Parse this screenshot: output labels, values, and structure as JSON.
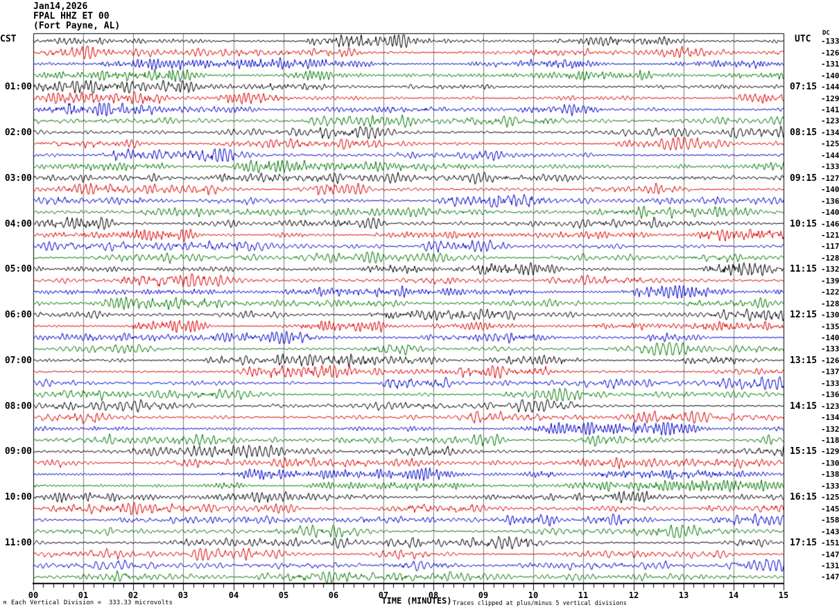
{
  "title_block": {
    "date": "Jan14,2026",
    "station": "FPAL HHZ ET 00",
    "location": "(Fort Payne, AL)"
  },
  "corner_labels": {
    "left_timezone": "CST",
    "right_timezone": "UTC",
    "dc_header": "DC"
  },
  "footer": {
    "mark": "M",
    "scale_note": "Each Vertical Division =  333.33 microvolts",
    "axis_title": "TIME (MINUTES)",
    "clip_note": "Traces clipped at plus/minus 5 vertical divisions"
  },
  "chart_data": {
    "type": "line",
    "subtype": "helicorder-seismogram",
    "station": "FPAL HHZ ET 00 (Fort Payne, AL)",
    "date": "Jan14,2026",
    "xlabel": "TIME (MINUTES)",
    "x_tick_labels": [
      "00",
      "01",
      "02",
      "03",
      "04",
      "05",
      "06",
      "07",
      "08",
      "09",
      "10",
      "11",
      "12",
      "13",
      "14",
      "15"
    ],
    "minutes_per_line": 15,
    "minor_ticks_per_minute": 5,
    "lines_per_hour": 4,
    "left_timezone": "CST",
    "right_timezone": "UTC",
    "volts_per_division": "333.33 microvolts",
    "clip_divisions": 5,
    "grid_on": true,
    "grid_color": "#7a7a7a",
    "trace_colors": [
      "#000000",
      "#dd0000",
      "#0000cc",
      "#007700"
    ],
    "waveform": {
      "description": "continuous microseismic background noise with spindle-shaped amplitude bursts on every line, clipped at plus/minus 5 vertical divisions",
      "seed": 20260114
    },
    "rows": [
      {
        "cst": "",
        "utc": "",
        "dc": "-133"
      },
      {
        "cst": "",
        "utc": "",
        "dc": "-126"
      },
      {
        "cst": "",
        "utc": "",
        "dc": "-131"
      },
      {
        "cst": "",
        "utc": "",
        "dc": "-140"
      },
      {
        "cst": "01:00",
        "utc": "07:15",
        "dc": "-144"
      },
      {
        "cst": "",
        "utc": "",
        "dc": "-129"
      },
      {
        "cst": "",
        "utc": "",
        "dc": "-141"
      },
      {
        "cst": "",
        "utc": "",
        "dc": "-123"
      },
      {
        "cst": "02:00",
        "utc": "08:15",
        "dc": "-134"
      },
      {
        "cst": "",
        "utc": "",
        "dc": "-125"
      },
      {
        "cst": "",
        "utc": "",
        "dc": "-144"
      },
      {
        "cst": "",
        "utc": "",
        "dc": "-133"
      },
      {
        "cst": "03:00",
        "utc": "09:15",
        "dc": "-127"
      },
      {
        "cst": "",
        "utc": "",
        "dc": "-140"
      },
      {
        "cst": "",
        "utc": "",
        "dc": "-136"
      },
      {
        "cst": "",
        "utc": "",
        "dc": "-140"
      },
      {
        "cst": "04:00",
        "utc": "10:15",
        "dc": "-146"
      },
      {
        "cst": "",
        "utc": "",
        "dc": "-121"
      },
      {
        "cst": "",
        "utc": "",
        "dc": "-117"
      },
      {
        "cst": "",
        "utc": "",
        "dc": "-128"
      },
      {
        "cst": "05:00",
        "utc": "11:15",
        "dc": "-132"
      },
      {
        "cst": "",
        "utc": "",
        "dc": "-139"
      },
      {
        "cst": "",
        "utc": "",
        "dc": "-122"
      },
      {
        "cst": "",
        "utc": "",
        "dc": "-128"
      },
      {
        "cst": "06:00",
        "utc": "12:15",
        "dc": "-130"
      },
      {
        "cst": "",
        "utc": "",
        "dc": "-135"
      },
      {
        "cst": "",
        "utc": "",
        "dc": "-140"
      },
      {
        "cst": "",
        "utc": "",
        "dc": "-133"
      },
      {
        "cst": "07:00",
        "utc": "13:15",
        "dc": "-126"
      },
      {
        "cst": "",
        "utc": "",
        "dc": "-137"
      },
      {
        "cst": "",
        "utc": "",
        "dc": "-133"
      },
      {
        "cst": "",
        "utc": "",
        "dc": "-136"
      },
      {
        "cst": "08:00",
        "utc": "14:15",
        "dc": "-123"
      },
      {
        "cst": "",
        "utc": "",
        "dc": "-134"
      },
      {
        "cst": "",
        "utc": "",
        "dc": "-132"
      },
      {
        "cst": "",
        "utc": "",
        "dc": "-118"
      },
      {
        "cst": "09:00",
        "utc": "15:15",
        "dc": "-129"
      },
      {
        "cst": "",
        "utc": "",
        "dc": "-130"
      },
      {
        "cst": "",
        "utc": "",
        "dc": "-138"
      },
      {
        "cst": "",
        "utc": "",
        "dc": "-133"
      },
      {
        "cst": "10:00",
        "utc": "16:15",
        "dc": "-125"
      },
      {
        "cst": "",
        "utc": "",
        "dc": "-145"
      },
      {
        "cst": "",
        "utc": "",
        "dc": "-158"
      },
      {
        "cst": "",
        "utc": "",
        "dc": "-143"
      },
      {
        "cst": "11:00",
        "utc": "17:15",
        "dc": "-151"
      },
      {
        "cst": "",
        "utc": "",
        "dc": "-147"
      },
      {
        "cst": "",
        "utc": "",
        "dc": "-131"
      },
      {
        "cst": "",
        "utc": "",
        "dc": "-147"
      }
    ]
  }
}
